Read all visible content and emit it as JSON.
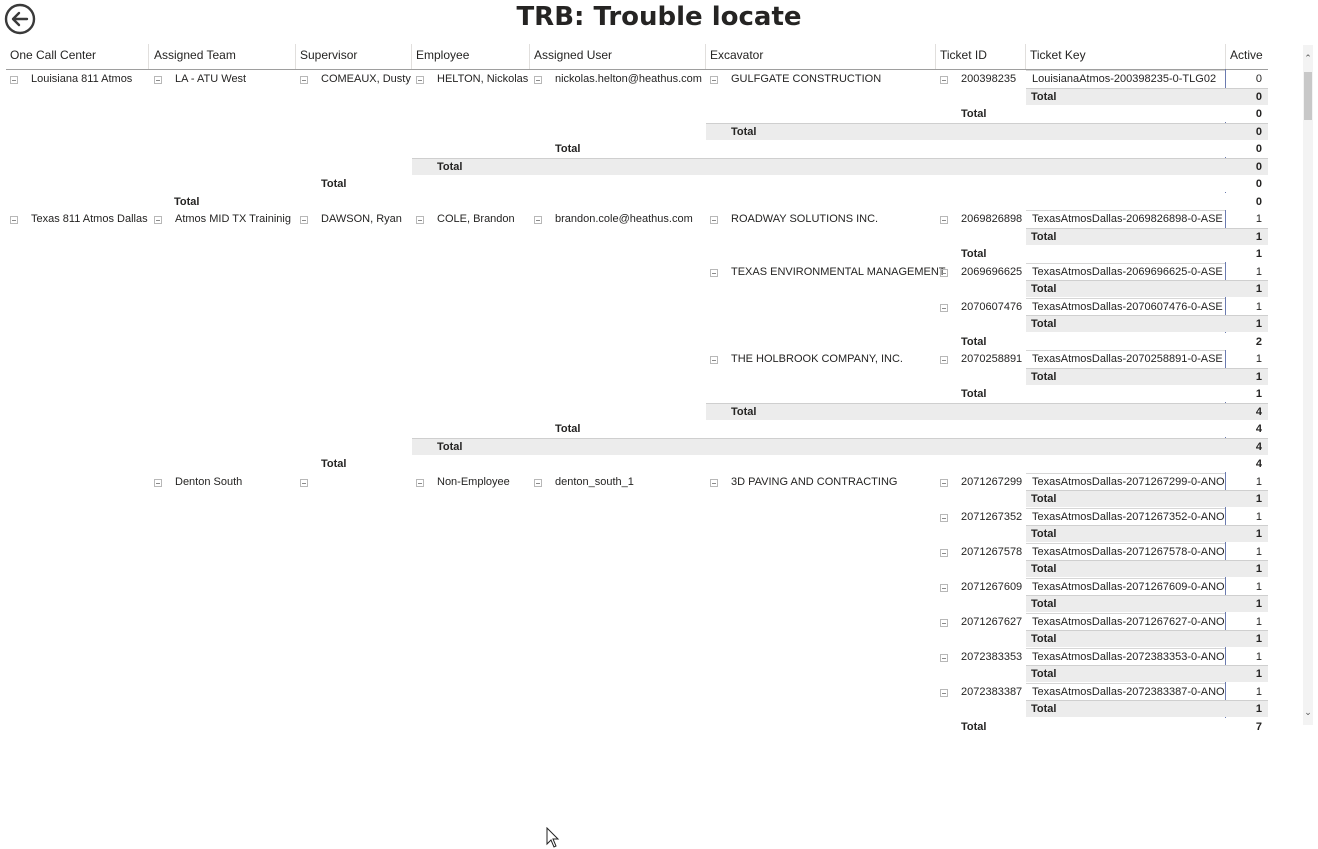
{
  "page": {
    "title": "TRB: Trouble locate"
  },
  "columns": [
    "One Call Center",
    "Assigned Team",
    "Supervisor",
    "Employee",
    "Assigned User",
    "Excavator",
    "Ticket ID",
    "Ticket Key",
    "Active"
  ],
  "labels": {
    "total": "Total"
  },
  "scrollbar": {
    "up": "⌃",
    "down": "⌄"
  },
  "rows": [
    {
      "id": "r1",
      "ticket_id": "200398235",
      "ticket_key": "LouisianaAtmos-200398235-0-TLG02",
      "active": "0",
      "onecall": "Louisiana 811 Atmos",
      "team": "LA - ATU West",
      "supervisor": "COMEAUX, Dusty",
      "employee": "HELTON, Nickolas",
      "user": "nickolas.helton@heathus.com",
      "excavator": "GULFGATE CONSTRUCTION"
    },
    {
      "id": "r2",
      "ticket_id": "2069826898",
      "ticket_key": "TexasAtmosDallas-2069826898-0-ASE",
      "active": "1",
      "onecall": "Texas 811 Atmos Dallas",
      "team": "Atmos MID TX Traininig",
      "supervisor": "DAWSON, Ryan",
      "employee": "COLE, Brandon",
      "user": "brandon.cole@heathus.com",
      "excavator": "ROADWAY SOLUTIONS INC."
    },
    {
      "id": "r3",
      "ticket_id": "2069696625",
      "ticket_key": "TexasAtmosDallas-2069696625-0-ASE",
      "active": "1",
      "excavator": "TEXAS ENVIRONMENTAL MANAGEMENT"
    },
    {
      "id": "r4",
      "ticket_id": "2070607476",
      "ticket_key": "TexasAtmosDallas-2070607476-0-ASE",
      "active": "1"
    },
    {
      "id": "r5",
      "ticket_id": "2070258891",
      "ticket_key": "TexasAtmosDallas-2070258891-0-ASE",
      "active": "1",
      "excavator": "THE HOLBROOK COMPANY, INC."
    },
    {
      "id": "r6",
      "ticket_id": "2071267299",
      "ticket_key": "TexasAtmosDallas-2071267299-0-ANO",
      "active": "1",
      "team": "Denton South",
      "employee": "Non-Employee",
      "user": "denton_south_1",
      "excavator": "3D PAVING AND CONTRACTING"
    },
    {
      "id": "r7",
      "ticket_id": "2071267352",
      "ticket_key": "TexasAtmosDallas-2071267352-0-ANO",
      "active": "1"
    },
    {
      "id": "r8",
      "ticket_id": "2071267578",
      "ticket_key": "TexasAtmosDallas-2071267578-0-ANO",
      "active": "1"
    },
    {
      "id": "r9",
      "ticket_id": "2071267609",
      "ticket_key": "TexasAtmosDallas-2071267609-0-ANO",
      "active": "1"
    },
    {
      "id": "r10",
      "ticket_id": "2071267627",
      "ticket_key": "TexasAtmosDallas-2071267627-0-ANO",
      "active": "1"
    },
    {
      "id": "r11",
      "ticket_id": "2072383353",
      "ticket_key": "TexasAtmosDallas-2072383353-0-ANO",
      "active": "1"
    },
    {
      "id": "r12",
      "ticket_id": "2072383387",
      "ticket_key": "TexasAtmosDallas-2072383387-0-ANO",
      "active": "1"
    }
  ],
  "totals": [
    {
      "level": "ticket_key",
      "value": "0"
    },
    {
      "level": "ticket_id",
      "value": "0"
    },
    {
      "level": "excavator",
      "value": "0"
    },
    {
      "level": "user",
      "value": "0"
    },
    {
      "level": "employee",
      "value": "0"
    },
    {
      "level": "supervisor",
      "value": "0"
    },
    {
      "level": "team",
      "value": "0"
    },
    {
      "level": "ticket_key",
      "value": "1"
    },
    {
      "level": "ticket_id",
      "value": "1"
    },
    {
      "level": "ticket_key",
      "value": "1"
    },
    {
      "level": "ticket_key",
      "value": "1"
    },
    {
      "level": "ticket_id",
      "value": "2"
    },
    {
      "level": "ticket_key",
      "value": "1"
    },
    {
      "level": "ticket_id",
      "value": "1"
    },
    {
      "level": "excavator",
      "value": "4"
    },
    {
      "level": "user",
      "value": "4"
    },
    {
      "level": "employee",
      "value": "4"
    },
    {
      "level": "supervisor",
      "value": "4"
    },
    {
      "level": "ticket_key",
      "value": "1"
    },
    {
      "level": "ticket_key",
      "value": "1"
    },
    {
      "level": "ticket_key",
      "value": "1"
    },
    {
      "level": "ticket_key",
      "value": "1"
    },
    {
      "level": "ticket_key",
      "value": "1"
    },
    {
      "level": "ticket_key",
      "value": "1"
    },
    {
      "level": "ticket_key",
      "value": "1"
    },
    {
      "level": "ticket_id",
      "value": "7"
    }
  ]
}
